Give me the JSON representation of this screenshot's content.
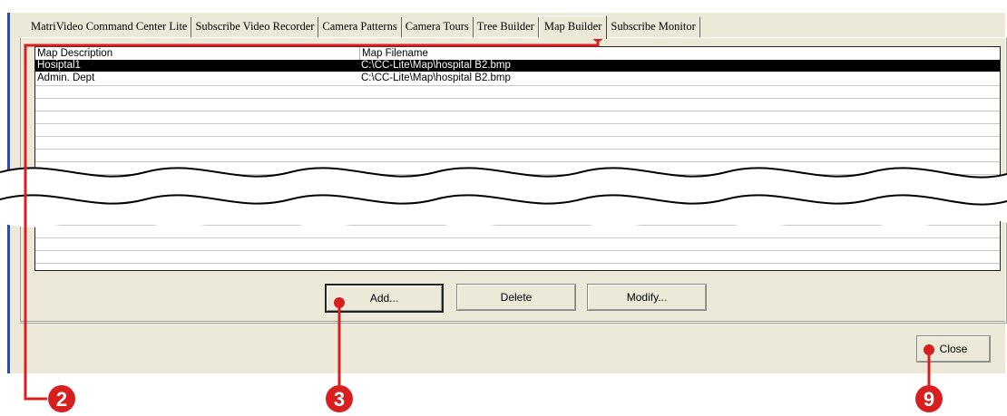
{
  "tabs": [
    {
      "label": "MatriVideo Command Center Lite",
      "active": false
    },
    {
      "label": "Subscribe Video Recorder",
      "active": false
    },
    {
      "label": "Camera Patterns",
      "active": false
    },
    {
      "label": "Camera Tours",
      "active": false
    },
    {
      "label": "Tree Builder",
      "active": false
    },
    {
      "label": "Map Builder",
      "active": true
    },
    {
      "label": "Subscribe Monitor",
      "active": false
    }
  ],
  "map_list": {
    "columns": [
      "Map Description",
      "Map Filename"
    ],
    "rows": [
      {
        "description": "Hosiptal1",
        "filename": "C:\\CC-Lite\\Map\\hospital B2.bmp",
        "selected": true
      },
      {
        "description": "Admin. Dept",
        "filename": "C:\\CC-Lite\\Map\\hospital B2.bmp",
        "selected": false
      }
    ]
  },
  "buttons": {
    "add": "Add...",
    "delete": "Delete",
    "modify": "Modify...",
    "close": "Close"
  },
  "callouts": {
    "tab_marker": "2",
    "add_marker": "3",
    "close_marker": "9"
  },
  "colors": {
    "callout_red": "#d81e1e",
    "window_bg": "#ece9d8",
    "selection": "#000000"
  }
}
